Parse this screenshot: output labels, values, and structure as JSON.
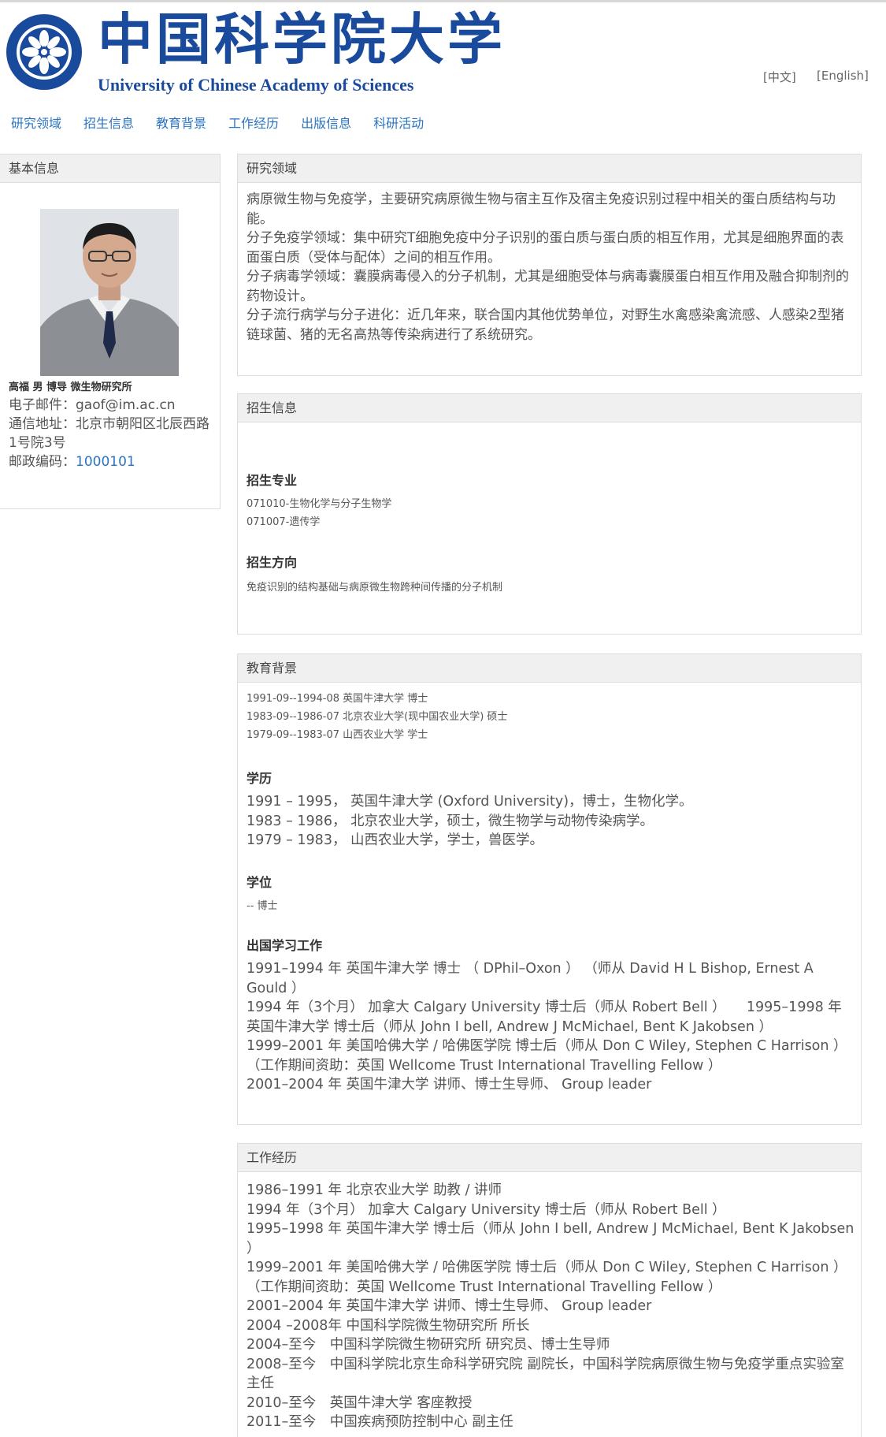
{
  "header": {
    "logo_cn": "中国科学院大学",
    "logo_en": "University of  Chinese Academy of Sciences",
    "lang_zh": "[中文]",
    "lang_en": "[English]"
  },
  "nav": [
    "研究领域",
    "招生信息",
    "教育背景",
    "工作经历",
    "出版信息",
    "科研活动"
  ],
  "profile": {
    "section_title": "基本信息",
    "short_bio": "高福 男 博导 微生物研究所",
    "email": "电子邮件：gaof@im.ac.cn",
    "address": "通信地址：北京市朝阳区北辰西路1号院3号",
    "zip_label": "邮政编码：",
    "zip_value": "1000101"
  },
  "research": {
    "title": "研究领域",
    "paragraphs": [
      "病原微生物与免疫学，主要研究病原微生物与宿主互作及宿主免疫识别过程中相关的蛋白质结构与功能。",
      "分子免疫学领域：集中研究T细胞免疫中分子识别的蛋白质与蛋白质的相互作用，尤其是细胞界面的表面蛋白质（受体与配体）之间的相互作用。",
      "分子病毒学领域：囊膜病毒侵入的分子机制，尤其是细胞受体与病毒囊膜蛋白相互作用及融合抑制剂的药物设计。",
      "分子流行病学与分子进化：近几年来，联合国内其他优势单位，对野生水禽感染禽流感、人感染2型猪链球菌、猪的无名高热等传染病进行了系统研究。"
    ]
  },
  "admissions": {
    "title": "招生信息",
    "major_title": "招生专业",
    "majors": [
      "071010-生物化学与分子生物学",
      "071007-遗传学"
    ],
    "direction_title": "招生方向",
    "direction": "免疫识别的结构基础与病原微生物跨种间传播的分子机制"
  },
  "education": {
    "title": "教育背景",
    "brief": [
      "1991-09--1994-08 英国牛津大学 博士",
      "1983-09--1986-07 北京农业大学(现中国农业大学) 硕士",
      "1979-09--1983-07 山西农业大学 学士"
    ],
    "degree_hist_title": "学历",
    "degree_hist": [
      "1991 – 1995， 英国牛津大学 (Oxford University)，博士，生物化学。",
      "1983 – 1986， 北京农业大学，硕士，微生物学与动物传染病学。",
      "1979 – 1983， 山西农业大学，学士，兽医学。"
    ],
    "degree_title": "学位",
    "degree": "-- 博士",
    "abroad_title": "出国学习工作",
    "abroad": [
      "1991–1994 年 英国牛津大学 博士 （ DPhil–Oxon ） （师从 David H L Bishop, Ernest A Gould ）",
      "1994 年（3个月） 加拿大 Calgary University 博士后（师从 Robert Bell ）　　1995–1998 年 英国牛津大学 博士后（师从 John I bell, Andrew J McMichael, Bent K Jakobsen ）",
      "1999–2001 年 美国哈佛大学 / 哈佛医学院 博士后（师从 Don C Wiley, Stephen C Harrison ）（工作期间资助：英国 Wellcome Trust International Travelling Fellow ）",
      "2001–2004 年 英国牛津大学 讲师、博士生导师、 Group leader"
    ]
  },
  "work": {
    "title": "工作经历",
    "items": [
      "1986–1991 年 北京农业大学 助教 / 讲师",
      "1994 年（3个月） 加拿大 Calgary University 博士后（师从 Robert Bell ）",
      "1995–1998 年 英国牛津大学 博士后（师从 John I bell, Andrew J McMichael, Bent K Jakobsen ）",
      "1999–2001 年 美国哈佛大学 / 哈佛医学院 博士后（师从 Don C Wiley, Stephen C Harrison ）（工作期间资助：英国 Wellcome Trust International Travelling Fellow ）",
      "2001–2004 年 英国牛津大学 讲师、博士生导师、 Group leader",
      "2004 –2008年 中国科学院微生物研究所 所长",
      "2004–至今　中国科学院微生物研究所 研究员、博士生导师",
      "2008–至今　中国科学院北京生命科学研究院 副院长，中国科学院病原微生物与免疫学重点实验室 主任",
      "2010–至今　英国牛津大学 客座教授",
      "2011–至今　中国疾病预防控制中心 副主任"
    ]
  }
}
